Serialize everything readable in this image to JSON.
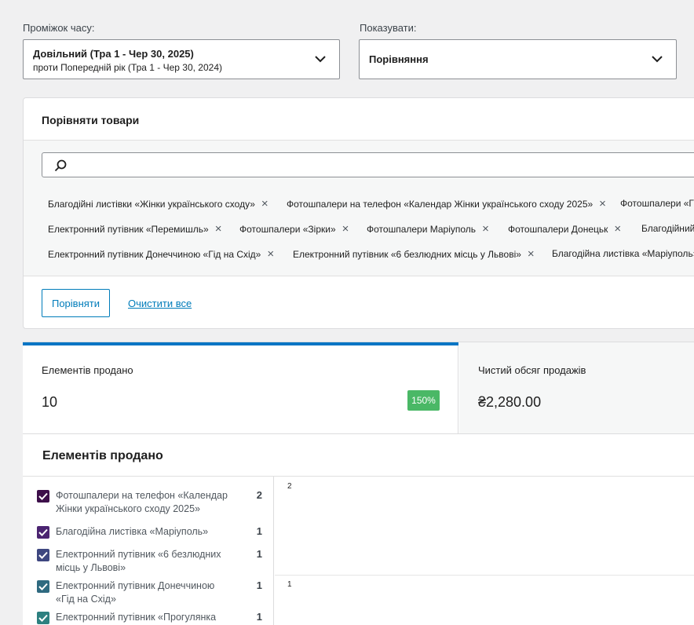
{
  "filters": {
    "period_label": "Проміжок часу:",
    "period_value": "Довільний (Тра 1 - Чер 30, 2025)",
    "period_compare": "проти Попередній рік (Тра 1 - Чер 30, 2024)",
    "show_label": "Показувати:",
    "show_value": "Порівняння"
  },
  "compare": {
    "title": "Порівняти товари",
    "search_placeholder": "",
    "tags": [
      "Благодійні листівки «Жінки українського сходу»",
      "Фотошпалери на телефон «Календар Жінки українського сходу 2025»",
      "Фотошпалери «Гі",
      "Електронний путівник «Перемишль»",
      "Фотошпалери «Зірки»",
      "Фотошпалери Маріуполь",
      "Фотошпалери Донецьк",
      "Благодійний",
      "Електронний путівник Донеччиною «Гід на Схід»",
      "Електронний путівник «6 безлюдних місць у Львові»",
      "Благодійна листівка «Маріуполь»"
    ],
    "compare_button": "Порівняти",
    "clear_link": "Очистити все"
  },
  "stats": [
    {
      "label": "Елементів продано",
      "value": "10",
      "delta": "150%"
    },
    {
      "label": "Чистий обсяг продажів",
      "value": "₴2,280.00"
    }
  ],
  "chart": {
    "title": "Елементів продано",
    "legend": [
      {
        "label": "Фотошпалери на телефон «Календар Жінки українського сходу 2025»",
        "count": "2",
        "color": "#3d0f4a"
      },
      {
        "label": "Благодійна листівка «Маріуполь»",
        "count": "1",
        "color": "#4b2471"
      },
      {
        "label": "Електронний путівник «6 безлюдних місць у Львові»",
        "count": "1",
        "color": "#3e4780"
      },
      {
        "label": "Електронний путівник Донеччиною «Гід на Схід»",
        "count": "1",
        "color": "#2f6a80"
      },
      {
        "label": "Електронний путівник «Прогулянка",
        "count": "1",
        "color": "#2d8080"
      }
    ],
    "y_ticks": [
      "2",
      "1"
    ]
  },
  "chart_data": {
    "type": "line",
    "title": "Елементів продано",
    "series": [
      {
        "name": "Фотошпалери на телефон «Календар Жінки українського сходу 2025»",
        "values": [
          2
        ]
      },
      {
        "name": "Благодійна листівка «Маріуполь»",
        "values": [
          1
        ]
      },
      {
        "name": "Електронний путівник «6 безлюдних місць у Львові»",
        "values": [
          1
        ]
      },
      {
        "name": "Електронний путівник Донеччиною «Гід на Схід»",
        "values": [
          1
        ]
      },
      {
        "name": "Електронний путівник «Прогулянка",
        "values": [
          1
        ]
      }
    ],
    "y_ticks": [
      2,
      1
    ],
    "grid": true
  }
}
